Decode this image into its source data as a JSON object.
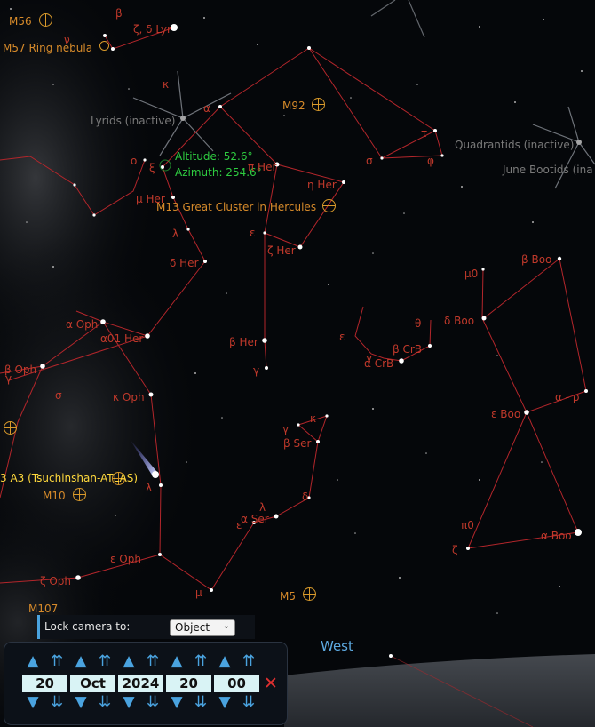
{
  "colors": {
    "constellation_line": "#b3262b",
    "label_red": "#c0392b",
    "messier": "#d99a2b",
    "accent": "#4aa3df"
  },
  "messier": {
    "m56": "M56",
    "m57": "M57 Ring nebula",
    "m92": "M92",
    "m13": "M13 Great Cluster in Hercules",
    "m10": "M10",
    "m5": "M5",
    "m107": "M107"
  },
  "showers": {
    "lyrids": "Lyrids (inactive)",
    "quadrantids": "Quadrantids (inactive)",
    "june_bootids": "June Bootids (ina"
  },
  "selection": {
    "altitude": "Altitude: 52.6°",
    "azimuth": "Azimuth: 254.6°"
  },
  "comet": "3 A3 (Tsuchinshan-ATLAS)",
  "star_labels": {
    "lyr_top": "β",
    "lyr": "ζ, δ Lyr",
    "nu_lyr": "ν",
    "kappa": "κ",
    "alpha": "α",
    "pi_her": "π Her",
    "eta_her": "η Her",
    "mu_her": "μ Her",
    "tau": "τ",
    "sigma": "σ",
    "phi": "φ",
    "lambda": "λ",
    "epsilon": "ε",
    "zeta_her": "ζ Her",
    "delta_her": "δ Her",
    "omicron": "ο",
    "xi": "ξ",
    "alpha_oph": "α Oph",
    "alpha01_her": "α01 Her",
    "beta_oph": "β Oph",
    "gamma_oph": "γ",
    "kappa_oph": "κ Oph",
    "beta_her": "β Her",
    "gamma": "γ",
    "sigma_oph": "σ",
    "lambda_oph": "λ",
    "zeta_oph": "ζ Oph",
    "eps_oph": "ε Oph",
    "mu_ser": "μ",
    "beta_boo": "β Boo",
    "mu0": "μ0",
    "delta_boo": "δ Boo",
    "theta": "θ",
    "beta_crb": "β CrB",
    "alpha_crb": "α CrB",
    "gamma_crb": "γ",
    "eps_crb": "ε",
    "eps_boo": "ε Boo",
    "alpha_p": "α - ρ",
    "gamma_ser": "γ",
    "kappa_ser": "κ",
    "beta_ser": "β Ser",
    "delta_ser": "δ",
    "lambda_ser": "λ",
    "alpha_ser": "α Ser",
    "eps_ser": "ε",
    "pi0": "π0",
    "zeta_boo": "ζ",
    "alpha_boo": "α Boo"
  },
  "horizon": {
    "west": "West"
  },
  "lock_camera": {
    "label": "Lock camera to:",
    "value": "Object"
  },
  "date": {
    "day": "20",
    "month": "Oct",
    "year": "2024",
    "hour": "20",
    "minute": "00",
    "up_small": "▲",
    "up_big": "⇈",
    "down_small": "▼",
    "down_big": "⇊",
    "close": "✕"
  }
}
